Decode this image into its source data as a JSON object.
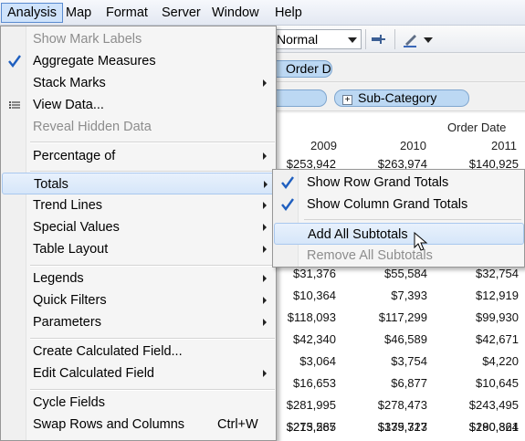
{
  "menubar": {
    "items": [
      "Analysis",
      "Map",
      "Format",
      "Server",
      "Window",
      "Help"
    ],
    "active": "Analysis"
  },
  "toolbar": {
    "fit_value": "Normal"
  },
  "shelves": {
    "columns_pill": "Order Da..",
    "rows_pill": "Sub-Category"
  },
  "table": {
    "header_top": "Order Date",
    "years": [
      "2009",
      "2010",
      "2011"
    ],
    "rows": [
      [
        "$253,942",
        "$263,974",
        "$140,925"
      ],
      [
        "$31,376",
        "$55,584",
        "$32,754"
      ],
      [
        "$10,364",
        "$7,393",
        "$12,919"
      ],
      [
        "$118,093",
        "$117,299",
        "$99,930"
      ],
      [
        "$42,340",
        "$46,589",
        "$42,671"
      ],
      [
        "$3,064",
        "$3,754",
        "$4,220"
      ],
      [
        "$16,653",
        "$6,877",
        "$10,645"
      ],
      [
        "$281,995",
        "$278,473",
        "$243,495"
      ],
      [
        "$215,565",
        "$175,327",
        "$190,364"
      ],
      [
        "$273,287",
        "$339,713",
        "$280,821"
      ]
    ]
  },
  "analysis_menu": {
    "show_mark_labels": "Show Mark Labels",
    "aggregate_measures": "Aggregate Measures",
    "stack_marks": "Stack Marks",
    "view_data": "View Data...",
    "reveal_hidden_data": "Reveal Hidden Data",
    "percentage_of": "Percentage of",
    "totals": "Totals",
    "trend_lines": "Trend Lines",
    "special_values": "Special Values",
    "table_layout": "Table Layout",
    "legends": "Legends",
    "quick_filters": "Quick Filters",
    "parameters": "Parameters",
    "create_calculated_field": "Create Calculated Field...",
    "edit_calculated_field": "Edit Calculated Field",
    "cycle_fields": "Cycle Fields",
    "swap_rows_columns": "Swap Rows and Columns",
    "swap_shortcut": "Ctrl+W"
  },
  "totals_submenu": {
    "show_row_grand_totals": "Show Row Grand Totals",
    "show_column_grand_totals": "Show Column Grand Totals",
    "add_all_subtotals": "Add All Subtotals",
    "remove_all_subtotals": "Remove All Subtotals"
  },
  "colors": {
    "check": "#1f5fbf",
    "highlight": "#d6e6f9",
    "pill": "#bcd8f3"
  },
  "icons": {
    "check": "check-icon",
    "view_data": "table-icon",
    "pin": "pin-icon",
    "pen": "pen-icon",
    "submenu_arrow": "chevron-right-icon",
    "cursor": "mouse-pointer-icon"
  }
}
